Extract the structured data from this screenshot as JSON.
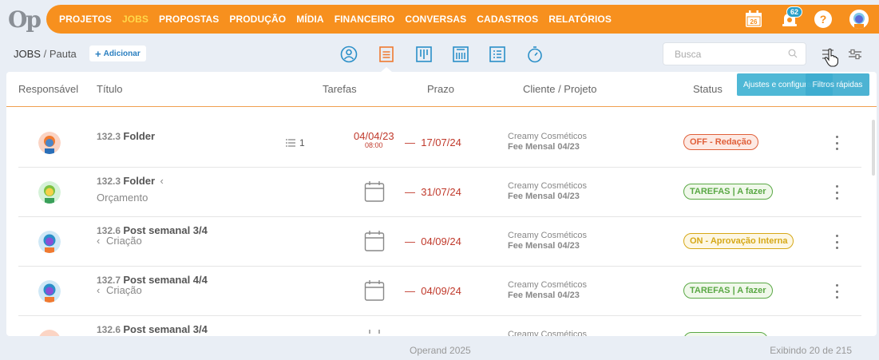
{
  "brand": {
    "logo_text": "Op",
    "accent": "#f7901e"
  },
  "nav": [
    {
      "label": "PROJETOS",
      "active": false
    },
    {
      "label": "JOBS",
      "active": true
    },
    {
      "label": "PROPOSTAS",
      "active": false
    },
    {
      "label": "PRODUÇÃO",
      "active": false
    },
    {
      "label": "MÍDIA",
      "active": false
    },
    {
      "label": "FINANCEIRO",
      "active": false
    },
    {
      "label": "CONVERSAS",
      "active": false
    },
    {
      "label": "CADASTROS",
      "active": false
    },
    {
      "label": "RELATÓRIOS",
      "active": false
    }
  ],
  "topbar": {
    "calendar_day": "26",
    "notifications": "62",
    "help": "?"
  },
  "breadcrumb": {
    "root": "JOBS",
    "sep": " / ",
    "current": "Pauta"
  },
  "add_button": {
    "plus": "+",
    "label": "Adicionar"
  },
  "search": {
    "placeholder": "Busca"
  },
  "tooltips": {
    "settings": "Ajustes e configurações",
    "filters": "Filtros rápidas"
  },
  "columns": {
    "responsavel": "Responsável",
    "titulo": "Título",
    "tarefas": "Tarefas",
    "prazo": "Prazo",
    "cliente": "Cliente / Projeto",
    "status": "Status"
  },
  "rows": [
    {
      "code": "132.3",
      "title": "Folder",
      "sub": "",
      "sub_arrow": "",
      "title_arrow": "",
      "tasks": "1",
      "start_date": "04/04/23",
      "start_time": "08:00",
      "dash": "—",
      "due": "17/07/24",
      "client": "Creamy Cosméticos",
      "project": "Fee Mensal 04/23",
      "status": "OFF - Redação",
      "status_kind": "off"
    },
    {
      "code": "132.3",
      "title": "Folder",
      "sub": "Orçamento",
      "sub_arrow": "",
      "title_arrow": "‹",
      "tasks": "",
      "start_date": "",
      "start_time": "",
      "dash": "—",
      "due": "31/07/24",
      "client": "Creamy Cosméticos",
      "project": "Fee Mensal 04/23",
      "status": "TAREFAS | A fazer",
      "status_kind": "tar"
    },
    {
      "code": "132.6",
      "title": "Post semanal 3/4",
      "sub": "Criação",
      "sub_arrow": "‹",
      "title_arrow": "",
      "tasks": "",
      "start_date": "",
      "start_time": "",
      "dash": "—",
      "due": "04/09/24",
      "client": "Creamy Cosméticos",
      "project": "Fee Mensal 04/23",
      "status": "ON - Aprovação Interna",
      "status_kind": "on"
    },
    {
      "code": "132.7",
      "title": "Post semanal 4/4",
      "sub": "Criação",
      "sub_arrow": "‹",
      "title_arrow": "",
      "tasks": "",
      "start_date": "",
      "start_time": "",
      "dash": "—",
      "due": "04/09/24",
      "client": "Creamy Cosméticos",
      "project": "Fee Mensal 04/23",
      "status": "TAREFAS | A fazer",
      "status_kind": "tar"
    }
  ],
  "partial_row": {
    "code": "132.6",
    "title": "Post semanal 3/4",
    "client": "Creamy Cosméticos"
  },
  "footer": {
    "copyright": "Operand 2025",
    "showing": "Exibindo 20 de 215"
  }
}
